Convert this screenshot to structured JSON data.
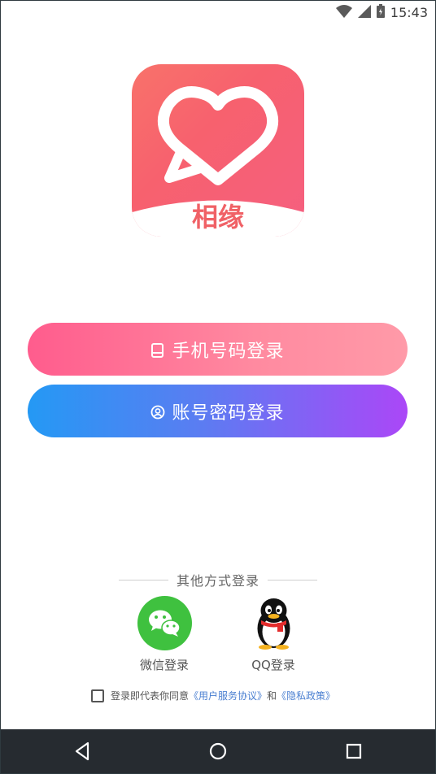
{
  "status_bar": {
    "time": "15:43",
    "icons": [
      "wifi-icon",
      "signal-icon",
      "battery-icon"
    ]
  },
  "logo": {
    "app_name": "相缘",
    "icon": "heart-chat-icon"
  },
  "buttons": {
    "phone_login": {
      "label": "手机号码登录",
      "icon": "phone-icon"
    },
    "account_login": {
      "label": "账号密码登录",
      "icon": "user-icon"
    }
  },
  "other_login": {
    "title": "其他方式登录",
    "options": [
      {
        "label": "微信登录",
        "icon": "wechat-icon",
        "color": "#3fc13f"
      },
      {
        "label": "QQ登录",
        "icon": "qq-penguin-icon"
      }
    ]
  },
  "agreement": {
    "checked": false,
    "prefix": "登录即代表你同意",
    "user_agreement": "《用户服务协议》",
    "and": "和",
    "privacy_policy": "《隐私政策》"
  },
  "nav_bar": {
    "buttons": [
      "back-icon",
      "home-icon",
      "recents-icon"
    ]
  }
}
